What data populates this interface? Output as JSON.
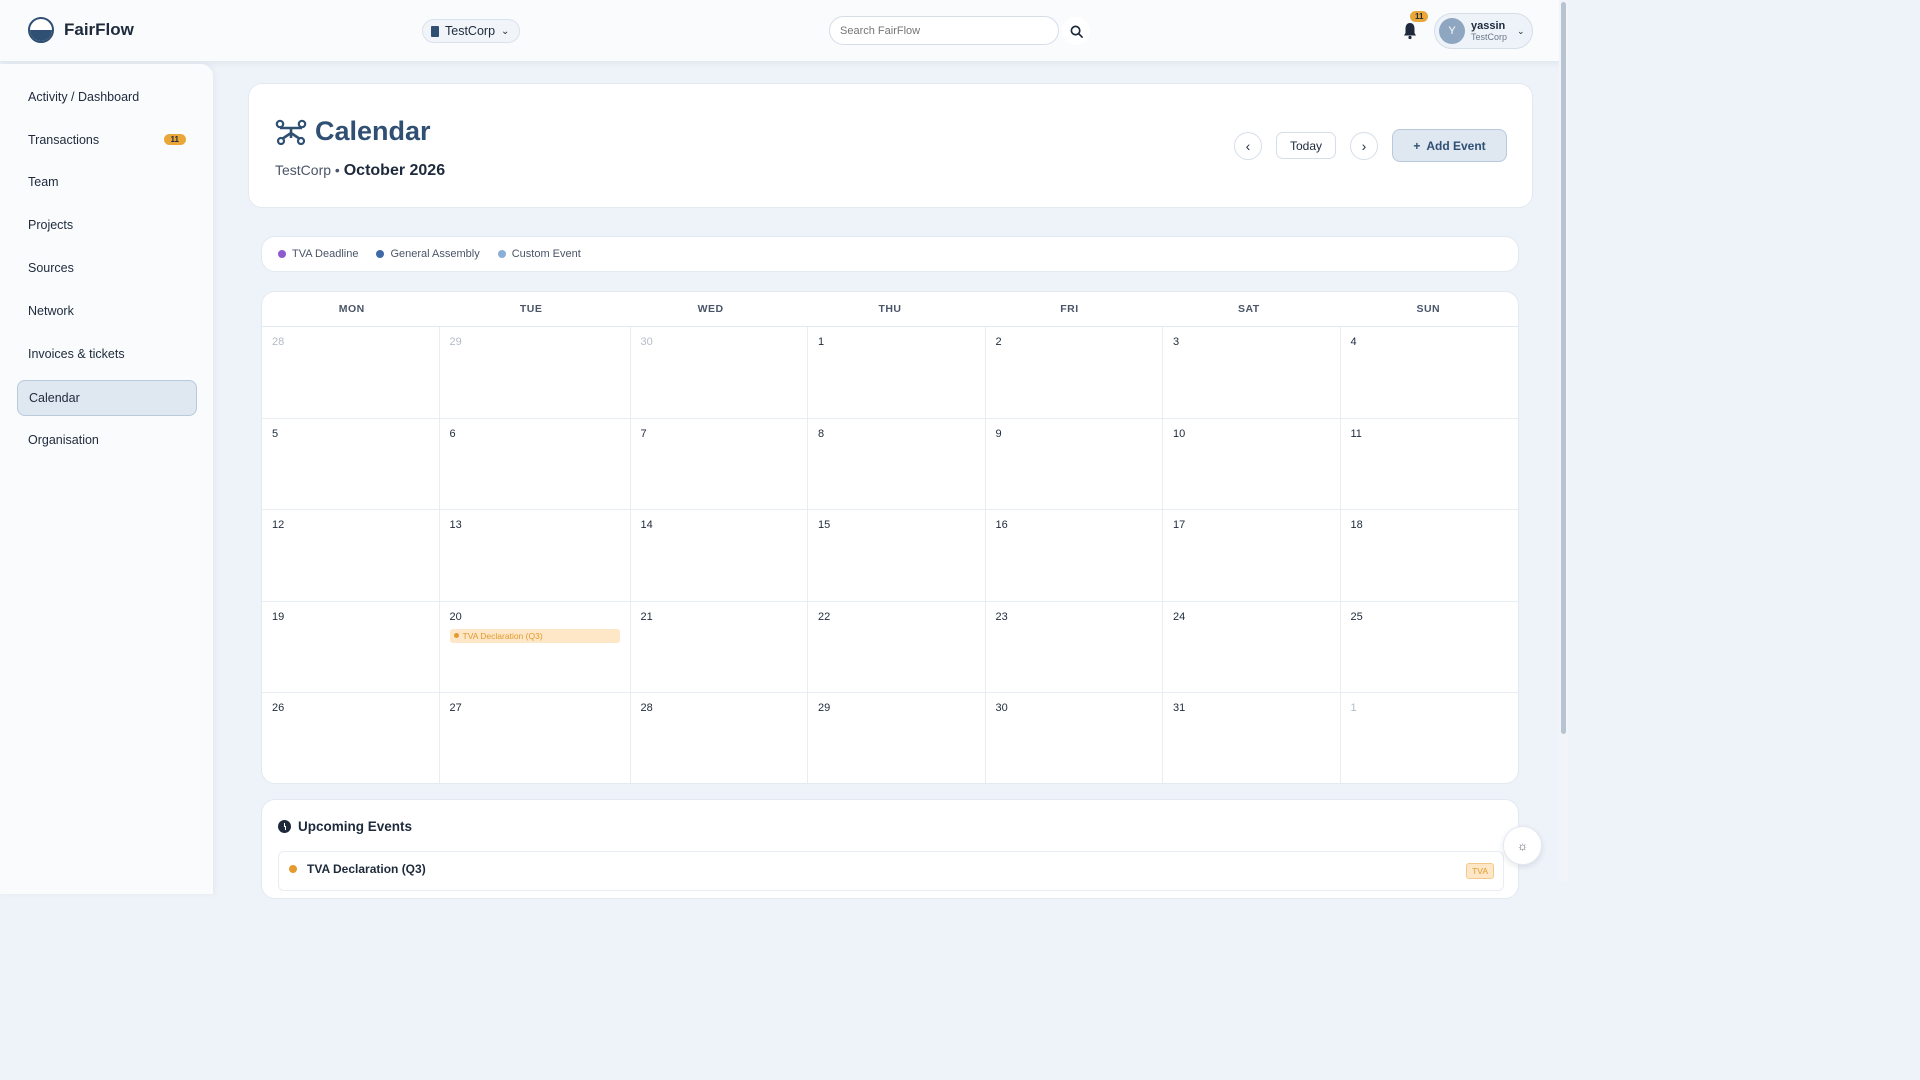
{
  "brand": {
    "name": "FairFlow"
  },
  "org_switcher": {
    "label": "TestCorp"
  },
  "search": {
    "placeholder": "Search FairFlow"
  },
  "notifications": {
    "count": "11"
  },
  "user": {
    "initial": "Y",
    "name": "yassin",
    "org": "TestCorp"
  },
  "sidebar": {
    "items": [
      {
        "label": "Activity / Dashboard"
      },
      {
        "label": "Transactions",
        "badge": "11"
      },
      {
        "label": "Team"
      },
      {
        "label": "Projects"
      },
      {
        "label": "Sources"
      },
      {
        "label": "Network"
      },
      {
        "label": "Invoices & tickets"
      },
      {
        "label": "Calendar",
        "active": true
      },
      {
        "label": "Organisation"
      }
    ]
  },
  "header": {
    "title": "Calendar",
    "org": "TestCorp",
    "separator": "•",
    "month": "October 2026",
    "today_label": "Today",
    "add_event_label": "Add Event"
  },
  "legend": [
    {
      "label": "TVA Deadline",
      "color": "#8e5ad0"
    },
    {
      "label": "General Assembly",
      "color": "#3f6aa8"
    },
    {
      "label": "Custom Event",
      "color": "#8aaed6"
    }
  ],
  "calendar": {
    "weekdays": [
      "MON",
      "TUE",
      "WED",
      "THU",
      "FRI",
      "SAT",
      "SUN"
    ],
    "days": [
      "28",
      "29",
      "30",
      "1",
      "2",
      "3",
      "4",
      "5",
      "6",
      "7",
      "8",
      "9",
      "10",
      "11",
      "12",
      "13",
      "14",
      "15",
      "16",
      "17",
      "18",
      "19",
      "20",
      "21",
      "22",
      "23",
      "24",
      "25",
      "26",
      "27",
      "28",
      "29",
      "30",
      "31",
      "1"
    ],
    "event": {
      "day": "20",
      "label": "TVA Declaration (Q3)",
      "color": "#e39a2e"
    }
  },
  "upcoming": {
    "title": "Upcoming Events",
    "items": [
      {
        "name": "TVA Declaration (Q3)",
        "tag": "TVA"
      }
    ]
  }
}
